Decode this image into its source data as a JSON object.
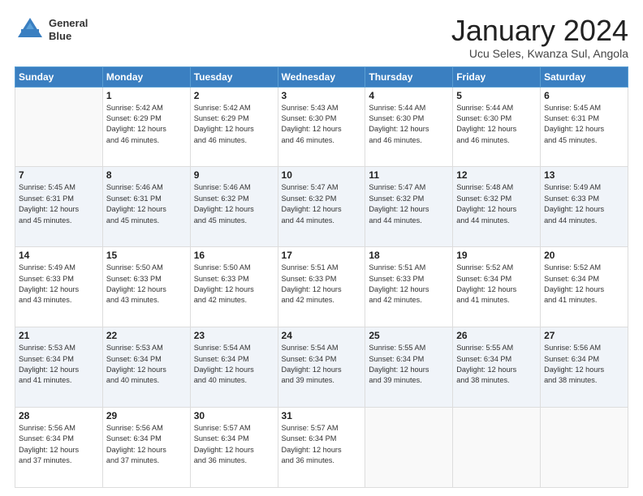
{
  "header": {
    "logo_line1": "General",
    "logo_line2": "Blue",
    "month_title": "January 2024",
    "location": "Ucu Seles, Kwanza Sul, Angola"
  },
  "days_of_week": [
    "Sunday",
    "Monday",
    "Tuesday",
    "Wednesday",
    "Thursday",
    "Friday",
    "Saturday"
  ],
  "weeks": [
    [
      {
        "day": "",
        "content": ""
      },
      {
        "day": "1",
        "content": "Sunrise: 5:42 AM\nSunset: 6:29 PM\nDaylight: 12 hours\nand 46 minutes."
      },
      {
        "day": "2",
        "content": "Sunrise: 5:42 AM\nSunset: 6:29 PM\nDaylight: 12 hours\nand 46 minutes."
      },
      {
        "day": "3",
        "content": "Sunrise: 5:43 AM\nSunset: 6:30 PM\nDaylight: 12 hours\nand 46 minutes."
      },
      {
        "day": "4",
        "content": "Sunrise: 5:44 AM\nSunset: 6:30 PM\nDaylight: 12 hours\nand 46 minutes."
      },
      {
        "day": "5",
        "content": "Sunrise: 5:44 AM\nSunset: 6:30 PM\nDaylight: 12 hours\nand 46 minutes."
      },
      {
        "day": "6",
        "content": "Sunrise: 5:45 AM\nSunset: 6:31 PM\nDaylight: 12 hours\nand 45 minutes."
      }
    ],
    [
      {
        "day": "7",
        "content": "Sunrise: 5:45 AM\nSunset: 6:31 PM\nDaylight: 12 hours\nand 45 minutes."
      },
      {
        "day": "8",
        "content": "Sunrise: 5:46 AM\nSunset: 6:31 PM\nDaylight: 12 hours\nand 45 minutes."
      },
      {
        "day": "9",
        "content": "Sunrise: 5:46 AM\nSunset: 6:32 PM\nDaylight: 12 hours\nand 45 minutes."
      },
      {
        "day": "10",
        "content": "Sunrise: 5:47 AM\nSunset: 6:32 PM\nDaylight: 12 hours\nand 44 minutes."
      },
      {
        "day": "11",
        "content": "Sunrise: 5:47 AM\nSunset: 6:32 PM\nDaylight: 12 hours\nand 44 minutes."
      },
      {
        "day": "12",
        "content": "Sunrise: 5:48 AM\nSunset: 6:32 PM\nDaylight: 12 hours\nand 44 minutes."
      },
      {
        "day": "13",
        "content": "Sunrise: 5:49 AM\nSunset: 6:33 PM\nDaylight: 12 hours\nand 44 minutes."
      }
    ],
    [
      {
        "day": "14",
        "content": "Sunrise: 5:49 AM\nSunset: 6:33 PM\nDaylight: 12 hours\nand 43 minutes."
      },
      {
        "day": "15",
        "content": "Sunrise: 5:50 AM\nSunset: 6:33 PM\nDaylight: 12 hours\nand 43 minutes."
      },
      {
        "day": "16",
        "content": "Sunrise: 5:50 AM\nSunset: 6:33 PM\nDaylight: 12 hours\nand 42 minutes."
      },
      {
        "day": "17",
        "content": "Sunrise: 5:51 AM\nSunset: 6:33 PM\nDaylight: 12 hours\nand 42 minutes."
      },
      {
        "day": "18",
        "content": "Sunrise: 5:51 AM\nSunset: 6:33 PM\nDaylight: 12 hours\nand 42 minutes."
      },
      {
        "day": "19",
        "content": "Sunrise: 5:52 AM\nSunset: 6:34 PM\nDaylight: 12 hours\nand 41 minutes."
      },
      {
        "day": "20",
        "content": "Sunrise: 5:52 AM\nSunset: 6:34 PM\nDaylight: 12 hours\nand 41 minutes."
      }
    ],
    [
      {
        "day": "21",
        "content": "Sunrise: 5:53 AM\nSunset: 6:34 PM\nDaylight: 12 hours\nand 41 minutes."
      },
      {
        "day": "22",
        "content": "Sunrise: 5:53 AM\nSunset: 6:34 PM\nDaylight: 12 hours\nand 40 minutes."
      },
      {
        "day": "23",
        "content": "Sunrise: 5:54 AM\nSunset: 6:34 PM\nDaylight: 12 hours\nand 40 minutes."
      },
      {
        "day": "24",
        "content": "Sunrise: 5:54 AM\nSunset: 6:34 PM\nDaylight: 12 hours\nand 39 minutes."
      },
      {
        "day": "25",
        "content": "Sunrise: 5:55 AM\nSunset: 6:34 PM\nDaylight: 12 hours\nand 39 minutes."
      },
      {
        "day": "26",
        "content": "Sunrise: 5:55 AM\nSunset: 6:34 PM\nDaylight: 12 hours\nand 38 minutes."
      },
      {
        "day": "27",
        "content": "Sunrise: 5:56 AM\nSunset: 6:34 PM\nDaylight: 12 hours\nand 38 minutes."
      }
    ],
    [
      {
        "day": "28",
        "content": "Sunrise: 5:56 AM\nSunset: 6:34 PM\nDaylight: 12 hours\nand 37 minutes."
      },
      {
        "day": "29",
        "content": "Sunrise: 5:56 AM\nSunset: 6:34 PM\nDaylight: 12 hours\nand 37 minutes."
      },
      {
        "day": "30",
        "content": "Sunrise: 5:57 AM\nSunset: 6:34 PM\nDaylight: 12 hours\nand 36 minutes."
      },
      {
        "day": "31",
        "content": "Sunrise: 5:57 AM\nSunset: 6:34 PM\nDaylight: 12 hours\nand 36 minutes."
      },
      {
        "day": "",
        "content": ""
      },
      {
        "day": "",
        "content": ""
      },
      {
        "day": "",
        "content": ""
      }
    ]
  ]
}
